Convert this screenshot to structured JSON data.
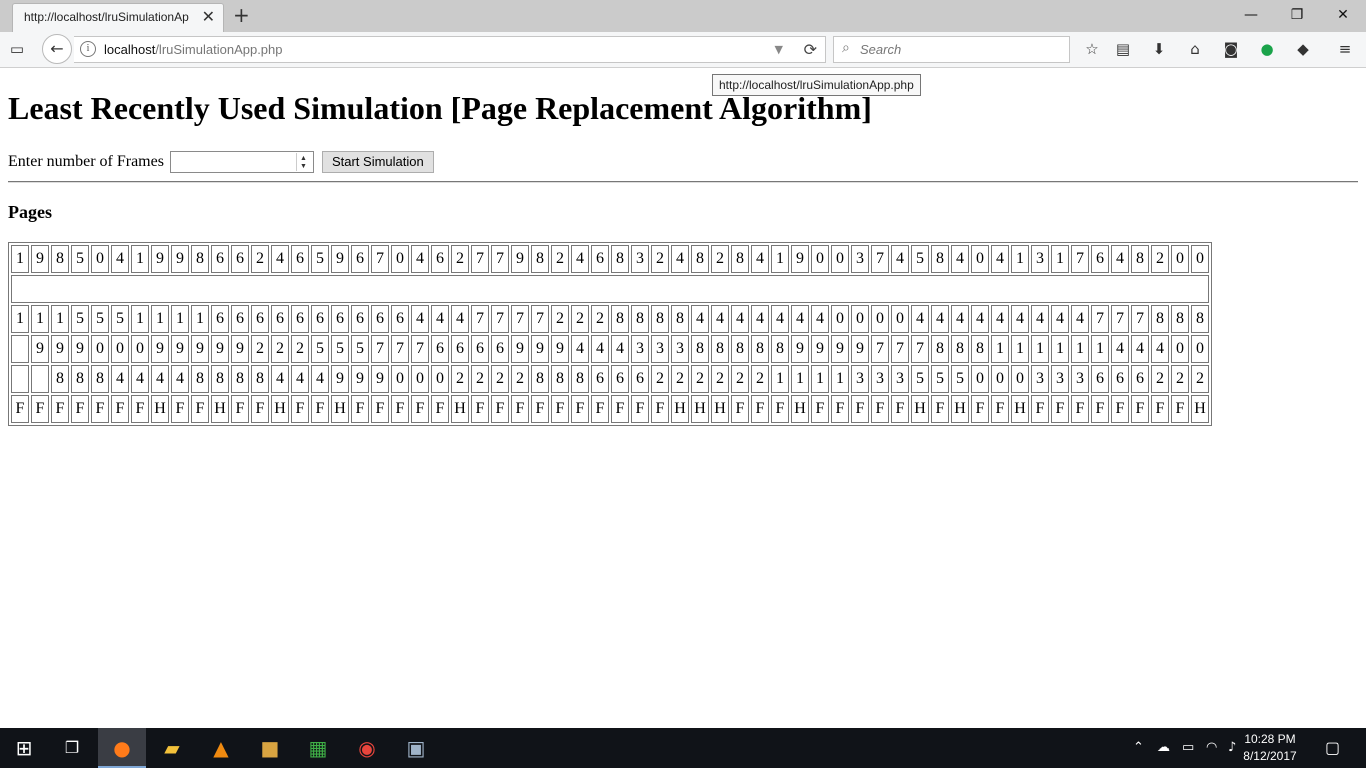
{
  "browser": {
    "tab_title": "http://localhost/lruSimulationAp",
    "new_tab_icon": "plus-icon",
    "url_host": "localhost",
    "url_path": "/lruSimulationApp.php",
    "search_placeholder": "Search",
    "tooltip": "http://localhost/lruSimulationApp.php"
  },
  "page": {
    "title": "Least Recently Used Simulation [Page Replacement Algorithm]",
    "frames_label": "Enter number of Frames",
    "frames_value": "",
    "start_button": "Start Simulation",
    "pages_heading": "Pages"
  },
  "simulation": {
    "pages": [
      "1",
      "9",
      "8",
      "5",
      "0",
      "4",
      "1",
      "9",
      "9",
      "8",
      "6",
      "6",
      "2",
      "4",
      "6",
      "5",
      "9",
      "6",
      "7",
      "0",
      "4",
      "6",
      "2",
      "7",
      "7",
      "9",
      "8",
      "2",
      "4",
      "6",
      "8",
      "3",
      "2",
      "4",
      "8",
      "2",
      "8",
      "4",
      "1",
      "9",
      "0",
      "0",
      "3",
      "7",
      "4",
      "5",
      "8",
      "4",
      "0",
      "4",
      "1",
      "3",
      "1",
      "7",
      "6",
      "4",
      "8",
      "2",
      "0",
      "0"
    ],
    "frames": [
      [
        "1",
        "1",
        "1",
        "5",
        "5",
        "5",
        "1",
        "1",
        "1",
        "1",
        "6",
        "6",
        "6",
        "6",
        "6",
        "6",
        "6",
        "6",
        "6",
        "6",
        "4",
        "4",
        "4",
        "7",
        "7",
        "7",
        "7",
        "2",
        "2",
        "2",
        "8",
        "8",
        "8",
        "8",
        "4",
        "4",
        "4",
        "4",
        "4",
        "4",
        "4",
        "0",
        "0",
        "0",
        "0",
        "4",
        "4",
        "4",
        "4",
        "4",
        "4",
        "4",
        "4",
        "4",
        "7",
        "7",
        "7",
        "8",
        "8",
        "8"
      ],
      [
        "",
        "9",
        "9",
        "9",
        "0",
        "0",
        "0",
        "9",
        "9",
        "9",
        "9",
        "9",
        "2",
        "2",
        "2",
        "5",
        "5",
        "5",
        "7",
        "7",
        "7",
        "6",
        "6",
        "6",
        "6",
        "9",
        "9",
        "9",
        "4",
        "4",
        "4",
        "3",
        "3",
        "3",
        "8",
        "8",
        "8",
        "8",
        "8",
        "9",
        "9",
        "9",
        "9",
        "7",
        "7",
        "7",
        "8",
        "8",
        "8",
        "1",
        "1",
        "1",
        "1",
        "1",
        "1",
        "4",
        "4",
        "4",
        "0",
        "0"
      ],
      [
        "",
        "",
        "8",
        "8",
        "8",
        "4",
        "4",
        "4",
        "4",
        "8",
        "8",
        "8",
        "8",
        "4",
        "4",
        "4",
        "9",
        "9",
        "9",
        "0",
        "0",
        "0",
        "2",
        "2",
        "2",
        "2",
        "8",
        "8",
        "8",
        "6",
        "6",
        "6",
        "2",
        "2",
        "2",
        "2",
        "2",
        "2",
        "1",
        "1",
        "1",
        "1",
        "3",
        "3",
        "3",
        "5",
        "5",
        "5",
        "0",
        "0",
        "0",
        "3",
        "3",
        "3",
        "6",
        "6",
        "6",
        "2",
        "2",
        "2"
      ]
    ],
    "results": [
      "F",
      "F",
      "F",
      "F",
      "F",
      "F",
      "F",
      "H",
      "F",
      "F",
      "H",
      "F",
      "F",
      "H",
      "F",
      "F",
      "H",
      "F",
      "F",
      "F",
      "F",
      "F",
      "H",
      "F",
      "F",
      "F",
      "F",
      "F",
      "F",
      "F",
      "F",
      "F",
      "F",
      "H",
      "H",
      "H",
      "F",
      "F",
      "F",
      "H",
      "F",
      "F",
      "F",
      "F",
      "F",
      "H",
      "F",
      "H",
      "F",
      "F",
      "H",
      "F",
      "F",
      "F",
      "F",
      "F",
      "F",
      "F",
      "F",
      "H"
    ]
  },
  "taskbar": {
    "clock_time": "10:28 PM",
    "clock_date": "8/12/2017"
  },
  "colors": {
    "tabstrip": "#cbcbcb",
    "navbar": "#f5f6f7",
    "taskbar": "#101318"
  }
}
